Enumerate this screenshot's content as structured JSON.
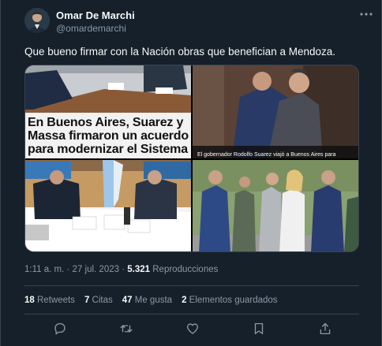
{
  "author": {
    "name": "Omar De Marchi",
    "handle": "@omardemarchi"
  },
  "tweet": {
    "text": "Que bueno firmar con la Nación obras que benefician a Mendoza."
  },
  "media": {
    "image1_headline": "En Buenos Aires, Suarez y Massa firmaron un acuerdo para modernizar el Sistema",
    "image2_caption": "El gobernador Rodolfo Suarez viajó a Buenos Aires para"
  },
  "meta": {
    "time": "1:11 a. m.",
    "separator": "·",
    "date": "27 jul. 2023",
    "views_count": "5.321",
    "views_label": "Reproducciones"
  },
  "stats": {
    "retweets_count": "18",
    "retweets_label": "Retweets",
    "quotes_count": "7",
    "quotes_label": "Citas",
    "likes_count": "47",
    "likes_label": "Me gusta",
    "bookmarks_count": "2",
    "bookmarks_label": "Elementos guardados"
  },
  "icons": {
    "reply": "reply-icon",
    "retweet": "retweet-icon",
    "like": "heart-icon",
    "bookmark": "bookmark-icon",
    "share": "share-icon",
    "more": "more-icon"
  },
  "colors": {
    "background": "#15202b",
    "primary_text": "#f7f9f9",
    "secondary_text": "#8b98a5",
    "border": "#38444d"
  }
}
